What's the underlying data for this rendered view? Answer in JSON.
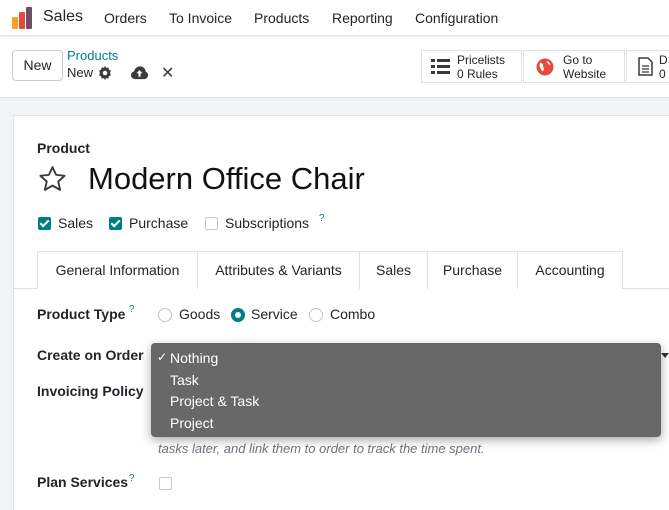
{
  "navbar": {
    "app_name": "Sales",
    "menu": [
      "Orders",
      "To Invoice",
      "Products",
      "Reporting",
      "Configuration"
    ]
  },
  "control_panel": {
    "new_label": "New",
    "breadcrumb_parent": "Products",
    "breadcrumb_current": "New",
    "smart_buttons": {
      "pricelists_title": "Pricelists",
      "pricelists_count": "0 Rules",
      "website_line1": "Go to",
      "website_line2": "Website",
      "doc_line1": "D",
      "doc_line2": "0"
    }
  },
  "form": {
    "product_label": "Product",
    "product_name": "Modern Office Chair",
    "checkboxes": [
      {
        "label": "Sales",
        "checked": true
      },
      {
        "label": "Purchase",
        "checked": true
      },
      {
        "label": "Subscriptions",
        "checked": false
      }
    ],
    "help_mark": "?",
    "tabs": [
      "General Information",
      "Attributes & Variants",
      "Sales",
      "Purchase",
      "Accounting"
    ],
    "active_tab": "General Information",
    "product_type_label": "Product Type",
    "product_type_options": [
      "Goods",
      "Service",
      "Combo"
    ],
    "product_type_selected": "Service",
    "create_on_order_label": "Create on Order",
    "invoicing_policy_label": "Invoicing Policy",
    "helper_text": "tasks later, and link them to order to track the time spent.",
    "plan_services_label": "Plan Services"
  },
  "dropdown": {
    "check_mark": "✓",
    "options": [
      "Nothing",
      "Task",
      "Project & Task",
      "Project"
    ],
    "selected": "Nothing"
  },
  "colors": {
    "accent": "#017e84",
    "dropdown_bg": "#686868",
    "logo_orange": "#f7a21b",
    "logo_red": "#e64a3c",
    "logo_purple": "#714b67"
  },
  "icons": {
    "star": "star-outline",
    "gear": "gear",
    "cloud": "cloud-upload",
    "close": "close-x",
    "pricelist": "list",
    "website": "globe",
    "document": "document"
  }
}
